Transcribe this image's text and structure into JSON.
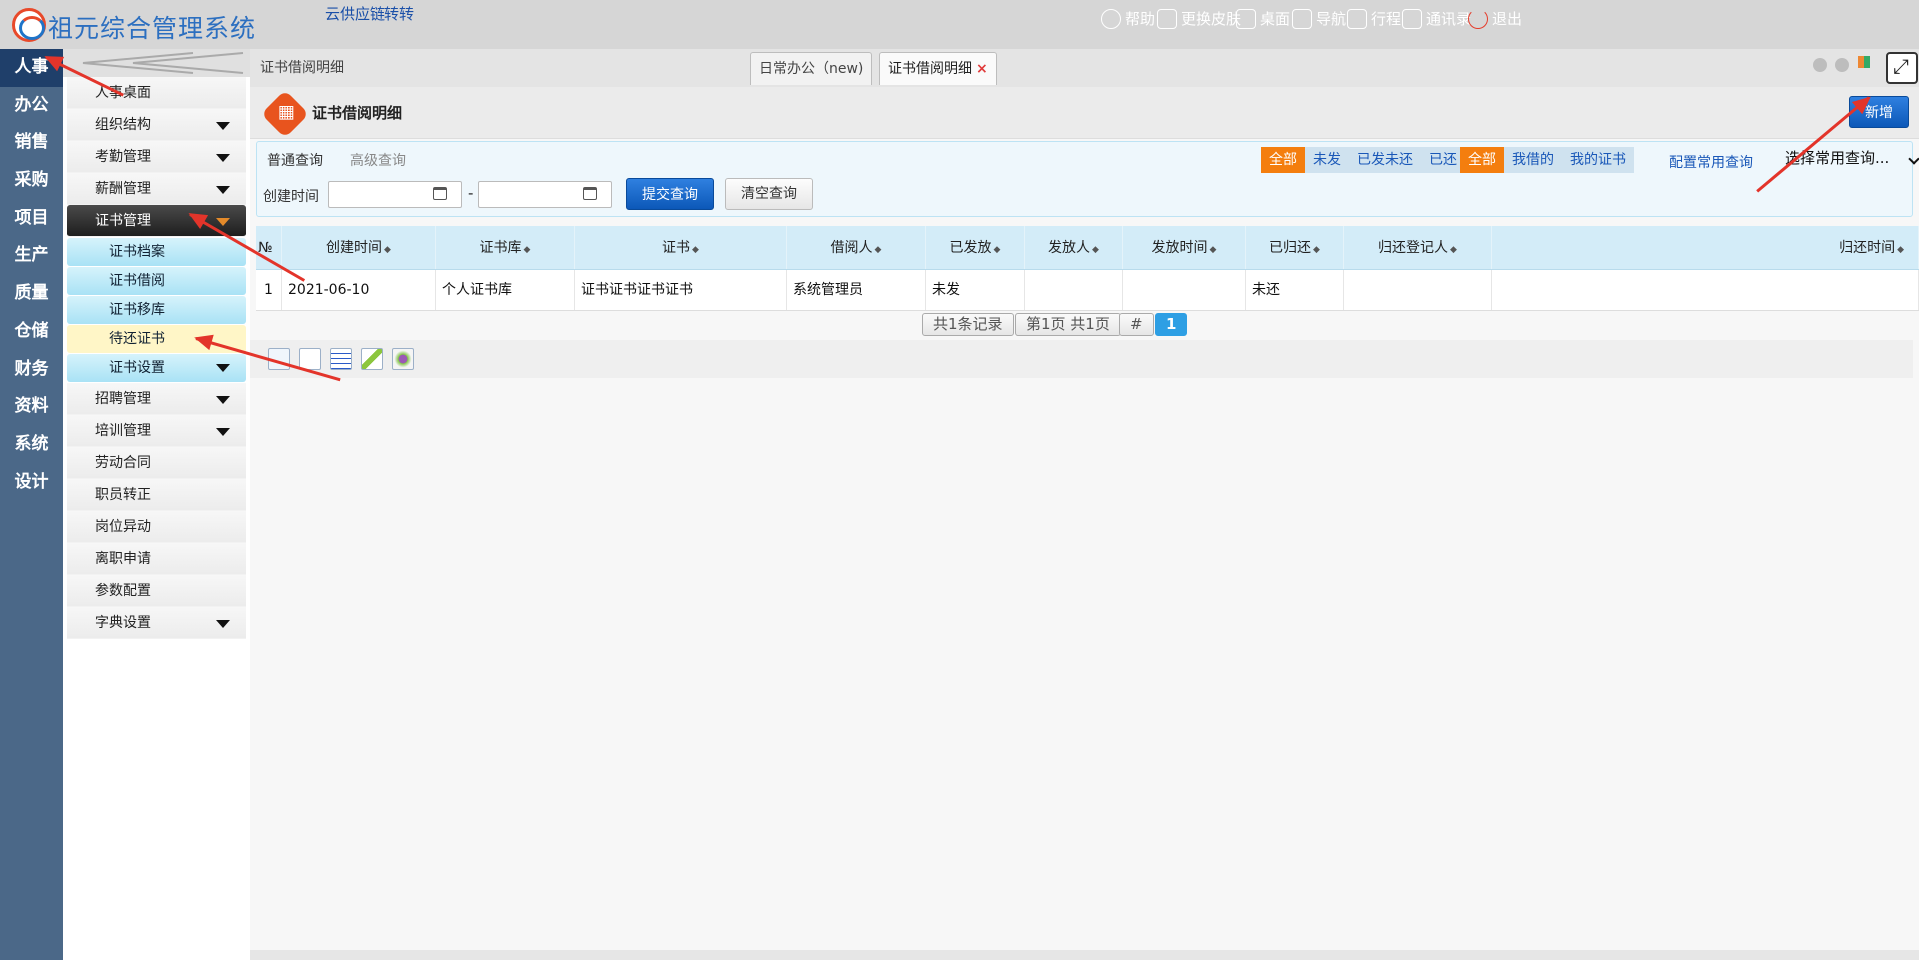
{
  "header": {
    "app_title": "祖元综合管理系统",
    "links": [
      "云供应链",
      "转转"
    ],
    "menu": [
      {
        "label": "帮助",
        "icon": "help-icon"
      },
      {
        "label": "更换皮肤",
        "icon": "shirt-icon"
      },
      {
        "label": "桌面",
        "icon": "home-icon"
      },
      {
        "label": "导航",
        "icon": "grid-icon"
      },
      {
        "label": "行程",
        "icon": "calendar-icon"
      },
      {
        "label": "通讯录",
        "icon": "contacts-icon"
      },
      {
        "label": "退出",
        "icon": "power-icon"
      }
    ]
  },
  "leftnav": [
    "人事",
    "办公",
    "销售",
    "采购",
    "项目",
    "生产",
    "质量",
    "仓储",
    "财务",
    "资料",
    "系统",
    "设计"
  ],
  "sidebar": {
    "items": [
      {
        "label": "人事桌面"
      },
      {
        "label": "组织结构"
      },
      {
        "label": "考勤管理"
      },
      {
        "label": "薪酬管理"
      },
      {
        "label": "证书管理"
      },
      {
        "label": "证书档案"
      },
      {
        "label": "证书借阅"
      },
      {
        "label": "证书移库"
      },
      {
        "label": "待还证书"
      },
      {
        "label": "证书设置"
      },
      {
        "label": "招聘管理"
      },
      {
        "label": "培训管理"
      },
      {
        "label": "劳动合同"
      },
      {
        "label": "职员转正"
      },
      {
        "label": "岗位异动"
      },
      {
        "label": "离职申请"
      },
      {
        "label": "参数配置"
      },
      {
        "label": "字典设置"
      }
    ]
  },
  "tabs": {
    "breadcrumb": "证书借阅明细",
    "items": [
      "日常办公（new)",
      "证书借阅明细"
    ],
    "close": "×"
  },
  "page": {
    "title": "证书借阅明细",
    "new_button": "新增"
  },
  "query": {
    "tab_normal": "普通查询",
    "tab_advanced": "高级查询",
    "date_label": "创建时间",
    "date_sep": "-",
    "submit": "提交查询",
    "clear": "清空查询",
    "filter1": [
      "全部",
      "未发",
      "已发未还",
      "已还"
    ],
    "filter2": [
      "全部",
      "我借的",
      "我的证书"
    ],
    "config_link": "配置常用查询",
    "saved_select": "选择常用查询..."
  },
  "table": {
    "headers": [
      "№",
      "创建时间",
      "证书库",
      "证书",
      "借阅人",
      "已发放",
      "发放人",
      "发放时间",
      "已归还",
      "归还登记人",
      "归还时间"
    ],
    "rows": [
      [
        "1",
        "2021-06-10",
        "个人证书库",
        "证书证书证书证书",
        "系统管理员",
        "未发",
        "",
        "",
        "未还",
        "",
        ""
      ]
    ]
  },
  "pager": {
    "total": "共1条记录",
    "pages": "第1页 共1页",
    "hash": "#",
    "current": "1"
  },
  "colors": {
    "leftnav_bg": "#4b6888",
    "accent_blue": "#0c58b8",
    "accent_orange": "#f47e0e",
    "annotation_red": "#e3342a"
  }
}
